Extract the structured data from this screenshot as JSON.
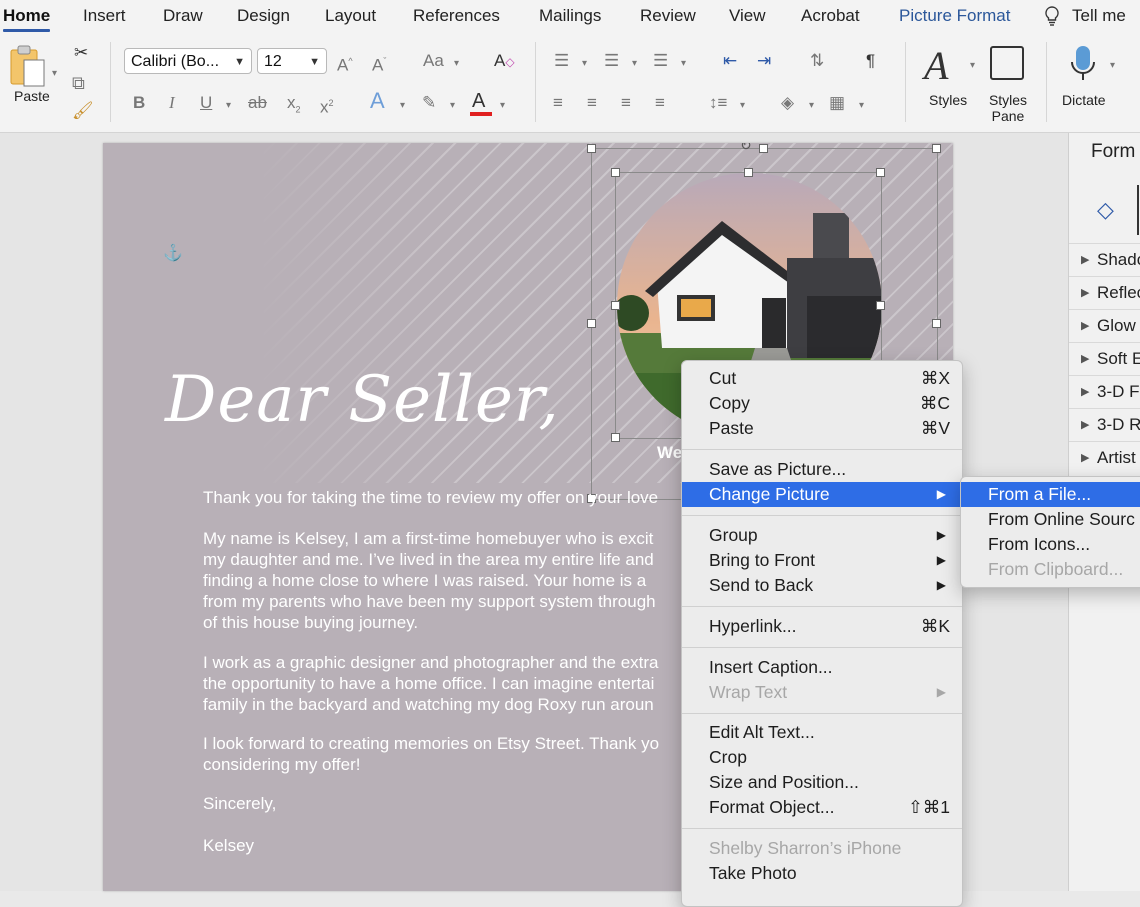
{
  "ribbon_tabs": [
    "Home",
    "Insert",
    "Draw",
    "Design",
    "Layout",
    "References",
    "Mailings",
    "Review",
    "View",
    "Acrobat",
    "Picture Format",
    "Tell me"
  ],
  "ribbon": {
    "paste_label": "Paste",
    "font_name": "Calibri (Bo...",
    "font_size": "12",
    "styles_label": "Styles",
    "styles_pane_label": "Styles Pane",
    "dictate_label": "Dictate"
  },
  "document": {
    "heading": "Dear Seller,",
    "caption_fragment": "We",
    "paragraphs": [
      "Thank you for taking the time to review my offer on your love",
      "My name is Kelsey, I am a first-time homebuyer who is excit\nmy daughter and me. I’ve lived in the area my entire life and\nfinding a home close to where I was raised. Your home is a \nfrom my parents who have been my support system through\nof this house buying journey.",
      "I work as a graphic designer and photographer and the extra\nthe opportunity to have a home office. I can imagine entertai\nfamily in the backyard and watching my dog Roxy run aroun",
      "I look forward to creating memories on Etsy Street. Thank yo\nconsidering my offer!",
      "Sincerely,",
      "Kelsey"
    ]
  },
  "pane": {
    "title": "Form",
    "rows": [
      "Shado",
      "Reflec",
      "Glow",
      "Soft E",
      "3-D F",
      "3-D R",
      "Artist"
    ]
  },
  "context_menu": {
    "items": [
      {
        "label": "Cut",
        "shortcut": "⌘X"
      },
      {
        "label": "Copy",
        "shortcut": "⌘C"
      },
      {
        "label": "Paste",
        "shortcut": "⌘V"
      },
      {
        "label": "Save as Picture..."
      },
      {
        "label": "Change Picture",
        "submenu": true,
        "highlighted": true
      },
      {
        "label": "Group",
        "submenu": true
      },
      {
        "label": "Bring to Front",
        "submenu": true
      },
      {
        "label": "Send to Back",
        "submenu": true
      },
      {
        "label": "Hyperlink...",
        "shortcut": "⌘K"
      },
      {
        "label": "Insert Caption..."
      },
      {
        "label": "Wrap Text",
        "submenu": true,
        "disabled": true
      },
      {
        "label": "Edit Alt Text..."
      },
      {
        "label": "Crop"
      },
      {
        "label": "Size and Position..."
      },
      {
        "label": "Format Object...",
        "shortcut": "⇧⌘1"
      },
      {
        "label": "Shelby Sharron’s iPhone",
        "disabled": true
      },
      {
        "label": "Take Photo"
      }
    ]
  },
  "submenu": {
    "items": [
      {
        "label": "From a File...",
        "highlighted": true
      },
      {
        "label": "From Online Sourc"
      },
      {
        "label": "From Icons..."
      },
      {
        "label": "From Clipboard...",
        "disabled": true
      }
    ]
  },
  "colors": {
    "accent": "#2f5aa8",
    "menu_highlight": "#2e6de6",
    "page_background": "#b8b0b7",
    "font_color_bar": "#e02020"
  }
}
